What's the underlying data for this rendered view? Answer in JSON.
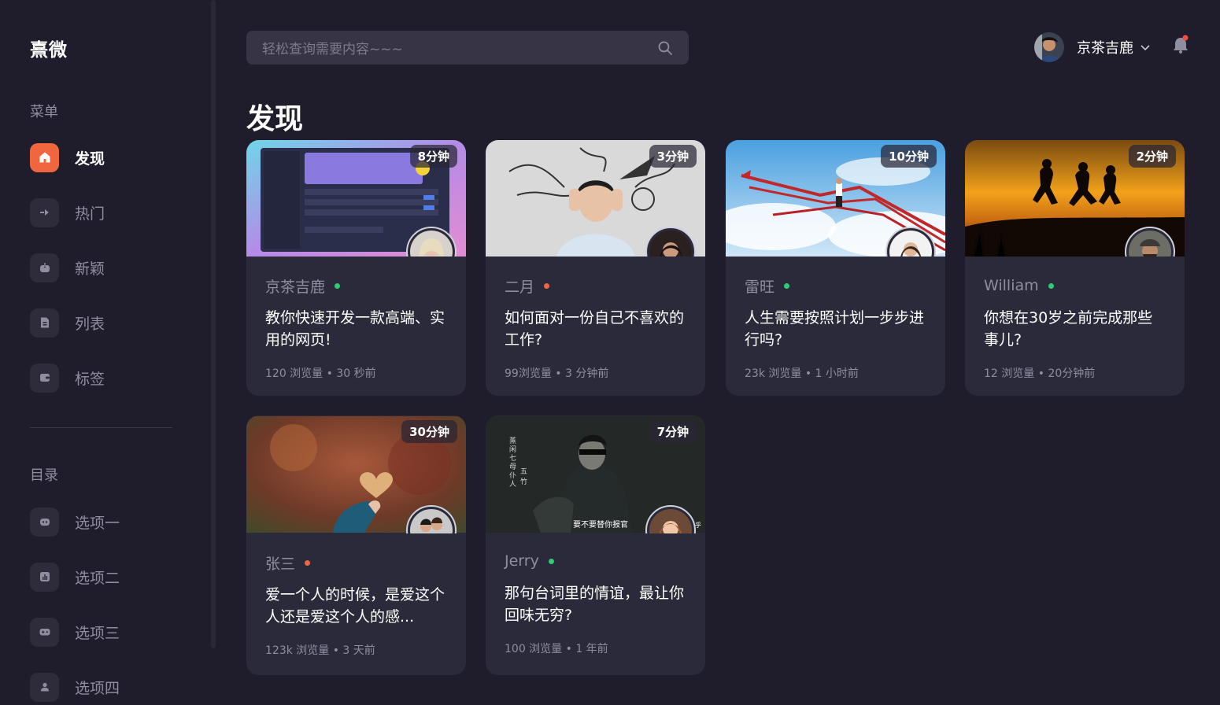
{
  "app": {
    "logo": "熹微"
  },
  "sidebar": {
    "menu_label": "菜单",
    "menu_items": [
      {
        "label": "发现",
        "icon": "home-icon",
        "active": true
      },
      {
        "label": "热门",
        "icon": "arrow-right-icon",
        "active": false
      },
      {
        "label": "新颖",
        "icon": "power-icon",
        "active": false
      },
      {
        "label": "列表",
        "icon": "document-icon",
        "active": false
      },
      {
        "label": "标签",
        "icon": "wallet-icon",
        "active": false
      }
    ],
    "catalog_label": "目录",
    "catalog_items": [
      {
        "label": "选项一",
        "icon": "gamepad-icon"
      },
      {
        "label": "选项二",
        "icon": "chart-icon"
      },
      {
        "label": "选项三",
        "icon": "gamepad-icon"
      },
      {
        "label": "选项四",
        "icon": "users-icon"
      }
    ]
  },
  "header": {
    "search_placeholder": "轻松查询需要内容~~~",
    "user_name": "京茶吉鹿"
  },
  "main": {
    "page_title": "发现",
    "cards": [
      {
        "duration": "8分钟",
        "author": "京茶吉鹿",
        "status_color": "#2ecc71",
        "title": "教你快速开发一款高端、实用的网页!",
        "meta": "120 浏览量 • 30 秒前",
        "cover": "ui-screenshot"
      },
      {
        "duration": "3分钟",
        "author": "二月",
        "status_color": "#f0663e",
        "title": "如何面对一份自己不喜欢的工作?",
        "meta": "99浏览量 • 3 分钟前",
        "cover": "stressed-woman"
      },
      {
        "duration": "10分钟",
        "author": "雷旺",
        "status_color": "#2ecc71",
        "title": "人生需要按照计划一步步进行吗?",
        "meta": "23k 浏览量 • 1 小时前",
        "cover": "arrows-sky"
      },
      {
        "duration": "2分钟",
        "author": "William",
        "status_color": "#2ecc71",
        "title": "你想在30岁之前完成那些事儿?",
        "meta": "12 浏览量 • 20分钟前",
        "cover": "sunset-jump"
      },
      {
        "duration": "30分钟",
        "author": "张三",
        "status_color": "#f0663e",
        "title": "爱一个人的时候，是爱这个人还是爱这个人的感...",
        "meta": "123k 浏览量 • 3 天前",
        "cover": "heart-leaf"
      },
      {
        "duration": "7分钟",
        "author": "Jerry",
        "status_color": "#2ecc71",
        "title": "那句台词里的情谊，最让你回味无穷?",
        "meta": "100 浏览量 • 1 年前",
        "cover": "movie-still"
      }
    ]
  },
  "cover_texts": {
    "movie_caption": "要不要替你报官",
    "movie_vertical_1": "蒸闲七母仆人",
    "movie_vertical_2": "五竹",
    "movie_watermark": "知乎"
  },
  "colors": {
    "accent": "#f0663e",
    "verified": "#1d8fe1",
    "background": "#1f1d2b",
    "card": "#2b2a3a"
  }
}
